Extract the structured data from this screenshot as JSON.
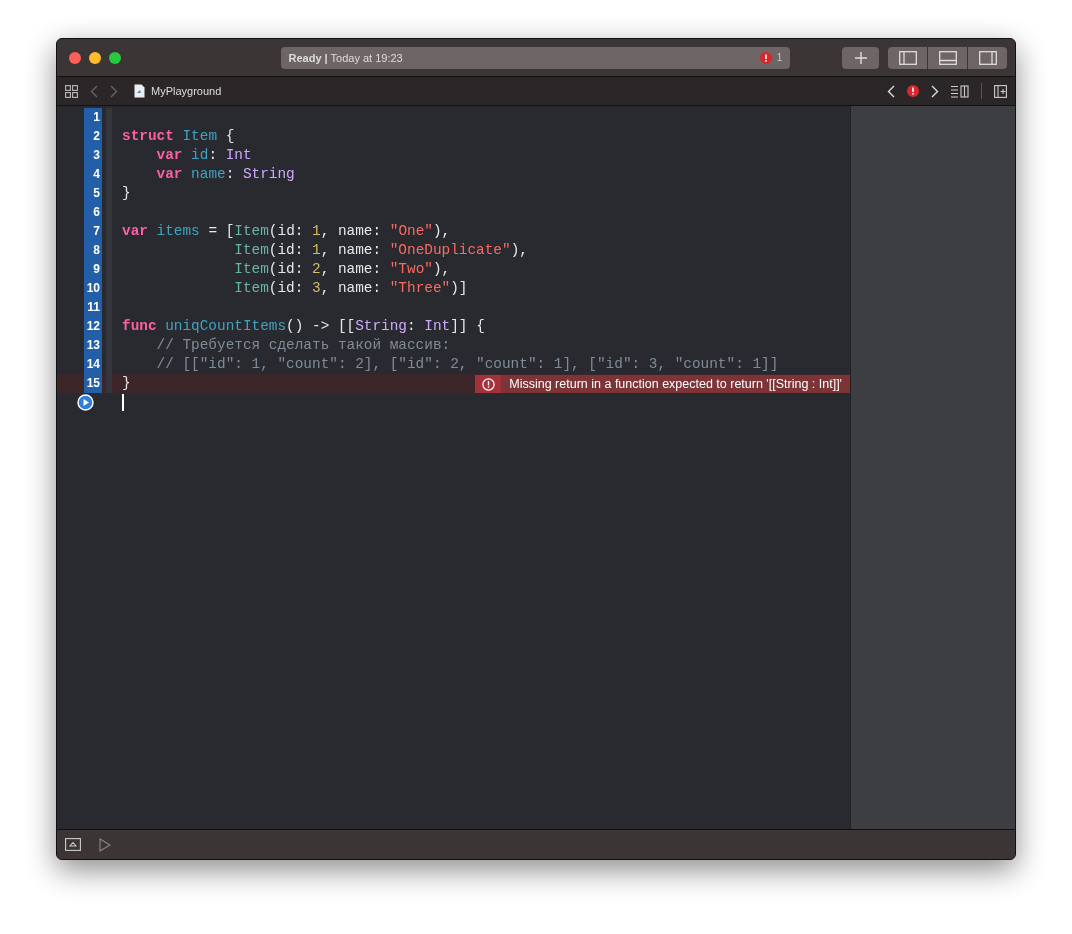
{
  "window": {
    "status": "**Ready |** Today at 19:23",
    "error_count": "1"
  },
  "breadcrumb": {
    "file": "MyPlayground"
  },
  "editor": {
    "lines": [
      {
        "kind": "code",
        "number": "1",
        "executed": true,
        "error": false
      },
      {
        "kind": "code",
        "number": "2",
        "executed": true,
        "error": false,
        "tokens": [
          {
            "kind": "kw",
            "text": "struct"
          },
          {
            "kind": "decl",
            "text": " Item"
          },
          {
            "kind": "plain",
            "text": " {"
          }
        ]
      },
      {
        "kind": "code",
        "number": "3",
        "executed": true,
        "error": false,
        "tokens": [
          {
            "kind": "kw",
            "text": "    var"
          },
          {
            "kind": "decl",
            "text": " id"
          },
          {
            "kind": "plain",
            "text": ":"
          },
          {
            "kind": "type",
            "text": " Int"
          }
        ]
      },
      {
        "kind": "code",
        "number": "4",
        "executed": true,
        "error": false,
        "tokens": [
          {
            "kind": "kw",
            "text": "    var"
          },
          {
            "kind": "decl",
            "text": " name"
          },
          {
            "kind": "plain",
            "text": ":"
          },
          {
            "kind": "type",
            "text": " String"
          }
        ]
      },
      {
        "kind": "code",
        "number": "5",
        "executed": true,
        "error": false,
        "tokens": [
          {
            "kind": "plain",
            "text": "}"
          }
        ]
      },
      {
        "kind": "code",
        "number": "6",
        "executed": true,
        "error": false
      },
      {
        "kind": "code",
        "number": "7",
        "executed": true,
        "error": false,
        "tokens": [
          {
            "kind": "kw",
            "text": "var"
          },
          {
            "kind": "decl",
            "text": " items"
          },
          {
            "kind": "plain",
            "text": " = ["
          },
          {
            "kind": "ref",
            "text": "Item"
          },
          {
            "kind": "plain",
            "text": "(id:"
          },
          {
            "kind": "num",
            "text": " 1"
          },
          {
            "kind": "plain",
            "text": ", name:"
          },
          {
            "kind": "str",
            "text": " \"One\""
          },
          {
            "kind": "plain",
            "text": "),"
          }
        ]
      },
      {
        "kind": "code",
        "number": "8",
        "executed": true,
        "error": false,
        "tokens": [
          {
            "kind": "ref",
            "text": "             Item"
          },
          {
            "kind": "plain",
            "text": "(id:"
          },
          {
            "kind": "num",
            "text": " 1"
          },
          {
            "kind": "plain",
            "text": ", name:"
          },
          {
            "kind": "str",
            "text": " \"OneDuplicate\""
          },
          {
            "kind": "plain",
            "text": "),"
          }
        ]
      },
      {
        "kind": "code",
        "number": "9",
        "executed": true,
        "error": false,
        "tokens": [
          {
            "kind": "ref",
            "text": "             Item"
          },
          {
            "kind": "plain",
            "text": "(id:"
          },
          {
            "kind": "num",
            "text": " 2"
          },
          {
            "kind": "plain",
            "text": ", name:"
          },
          {
            "kind": "str",
            "text": " \"Two\""
          },
          {
            "kind": "plain",
            "text": "),"
          }
        ]
      },
      {
        "kind": "code",
        "number": "10",
        "executed": true,
        "error": false,
        "tokens": [
          {
            "kind": "ref",
            "text": "             Item"
          },
          {
            "kind": "plain",
            "text": "(id:"
          },
          {
            "kind": "num",
            "text": " 3"
          },
          {
            "kind": "plain",
            "text": ", name:"
          },
          {
            "kind": "str",
            "text": " \"Three\""
          },
          {
            "kind": "plain",
            "text": ")]"
          }
        ]
      },
      {
        "kind": "code",
        "number": "11",
        "executed": true,
        "error": false
      },
      {
        "kind": "code",
        "number": "12",
        "executed": true,
        "error": false,
        "tokens": [
          {
            "kind": "kw",
            "text": "func"
          },
          {
            "kind": "decl",
            "text": " uniqCountItems"
          },
          {
            "kind": "plain",
            "text": "() -> [["
          },
          {
            "kind": "type",
            "text": "String"
          },
          {
            "kind": "plain",
            "text": ":"
          },
          {
            "kind": "type",
            "text": " Int"
          },
          {
            "kind": "plain",
            "text": "]] {"
          }
        ]
      },
      {
        "kind": "code",
        "number": "13",
        "executed": true,
        "error": false,
        "tokens": [
          {
            "kind": "comment",
            "text": "    // Требуется сделать такой массив:"
          }
        ]
      },
      {
        "kind": "code",
        "number": "14",
        "executed": true,
        "error": false,
        "tokens": [
          {
            "kind": "comment",
            "text": "    // [[\"id\": 1, \"count\": 2], [\"id\": 2, \"count\": 1], [\"id\": 3, \"count\": 1]]"
          }
        ]
      },
      {
        "kind": "code",
        "number": "15",
        "executed": true,
        "error": true,
        "message": "Missing return in a function expected to return '[[String : Int]]'",
        "tokens": [
          {
            "kind": "plain",
            "text": "}"
          }
        ]
      },
      {
        "kind": "run",
        "error": false
      }
    ]
  }
}
